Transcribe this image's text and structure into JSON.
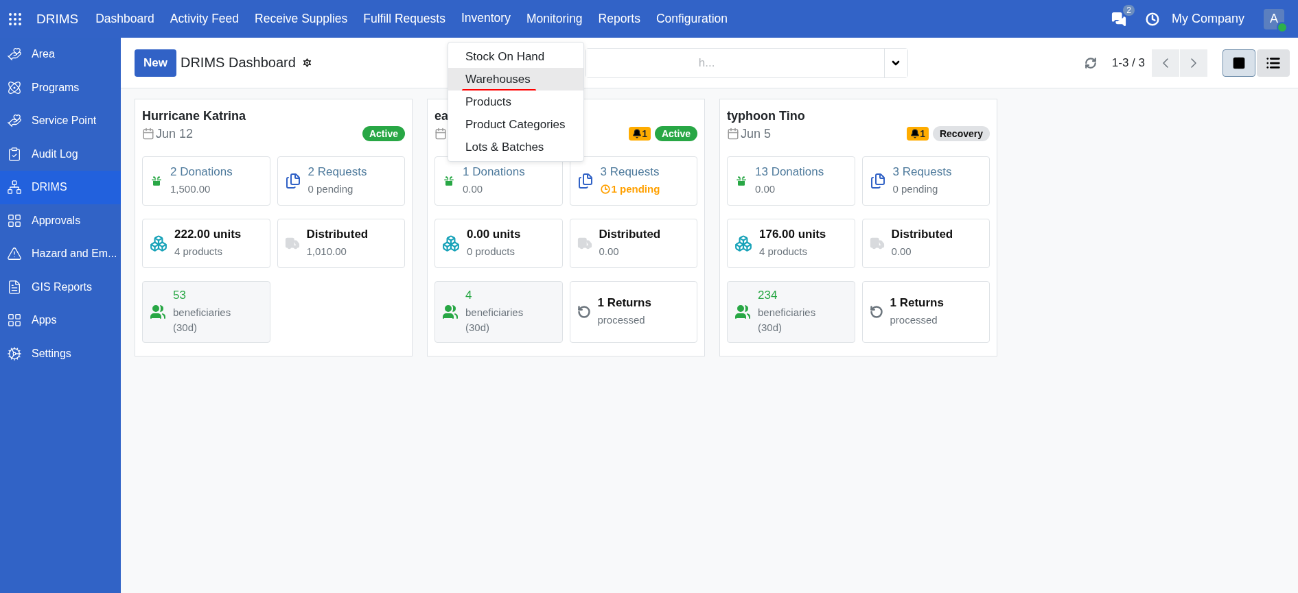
{
  "topbar": {
    "app": "DRIMS",
    "menu": [
      {
        "label": "Dashboard"
      },
      {
        "label": "Activity Feed"
      },
      {
        "label": "Receive Supplies"
      },
      {
        "label": "Fulfill Requests"
      },
      {
        "label": "Inventory",
        "expanded": true
      },
      {
        "label": "Monitoring"
      },
      {
        "label": "Reports"
      },
      {
        "label": "Configuration"
      }
    ],
    "messages_badge": "2",
    "company": "My Company",
    "avatar": "A"
  },
  "dropdown": {
    "items": [
      {
        "label": "Stock On Hand",
        "highlighted": false,
        "underlined": false
      },
      {
        "label": "Warehouses",
        "highlighted": true,
        "underlined": true
      },
      {
        "label": "Products",
        "highlighted": false,
        "underlined": false
      },
      {
        "label": "Product Categories",
        "highlighted": false,
        "underlined": false
      },
      {
        "label": "Lots & Batches",
        "highlighted": false,
        "underlined": false
      }
    ]
  },
  "sidebar": {
    "items": [
      {
        "label": "Area",
        "selected": false
      },
      {
        "label": "Programs",
        "selected": false
      },
      {
        "label": "Service Point",
        "selected": false
      },
      {
        "label": "Audit Log",
        "selected": false
      },
      {
        "label": "DRIMS",
        "selected": true
      },
      {
        "label": "Approvals",
        "selected": false
      },
      {
        "label": "Hazard and Em...",
        "selected": false
      },
      {
        "label": "GIS Reports",
        "selected": false
      },
      {
        "label": "Apps",
        "selected": false
      },
      {
        "label": "Settings",
        "selected": false
      }
    ]
  },
  "control_panel": {
    "new_button": "New",
    "title": "DRIMS Dashboard",
    "search": {
      "placeholder": "h..."
    },
    "pager": "1-3 / 3",
    "views": [
      {
        "kind": "kanban",
        "selected": true
      },
      {
        "kind": "list",
        "selected": false
      }
    ]
  },
  "cards": [
    {
      "title": "Hurricane Katrina",
      "date": "Jun 12",
      "status": {
        "label": "Active",
        "kind": "active"
      },
      "tiles": [
        {
          "kind": "donations",
          "title": "2 Donations",
          "sub": "1,500.00",
          "warning": false
        },
        {
          "kind": "requests",
          "title": "2 Requests",
          "sub": "0 pending",
          "warning": false
        },
        {
          "kind": "stock",
          "title": "222.00 units",
          "sub": "4 products",
          "warning": false
        },
        {
          "kind": "distributed",
          "title": "Distributed",
          "sub": "1,010.00",
          "warning": false
        },
        {
          "kind": "beneficiaries",
          "title": "53",
          "sub": "beneficiaries (30d)",
          "warning": false
        }
      ]
    },
    {
      "title": "ea",
      "alert": "1",
      "status": {
        "label": "Active",
        "kind": "active"
      },
      "tiles": [
        {
          "kind": "donations",
          "title": "1 Donations",
          "sub": "0.00",
          "warning": false
        },
        {
          "kind": "requests",
          "title": "3 Requests",
          "sub": "1 pending",
          "warning": true
        },
        {
          "kind": "stock",
          "title": "0.00 units",
          "sub": "0 products",
          "warning": false
        },
        {
          "kind": "distributed",
          "title": "Distributed",
          "sub": "0.00",
          "warning": false
        },
        {
          "kind": "beneficiaries",
          "title": "4",
          "sub": "beneficiaries (30d)",
          "warning": false
        },
        {
          "kind": "returns",
          "title": "1 Returns",
          "sub": "processed",
          "warning": false
        }
      ]
    },
    {
      "title": "typhoon Tino",
      "date": "Jun 5",
      "alert": "1",
      "status": {
        "label": "Recovery",
        "kind": "recovery"
      },
      "tiles": [
        {
          "kind": "donations",
          "title": "13 Donations",
          "sub": "0.00",
          "warning": false
        },
        {
          "kind": "requests",
          "title": "3 Requests",
          "sub": "0 pending",
          "warning": false
        },
        {
          "kind": "stock",
          "title": "176.00 units",
          "sub": "4 products",
          "warning": false
        },
        {
          "kind": "distributed",
          "title": "Distributed",
          "sub": "0.00",
          "warning": false
        },
        {
          "kind": "beneficiaries",
          "title": "234",
          "sub": "beneficiaries (30d)",
          "warning": false
        },
        {
          "kind": "returns",
          "title": "1 Returns",
          "sub": "processed",
          "warning": false
        }
      ]
    }
  ]
}
